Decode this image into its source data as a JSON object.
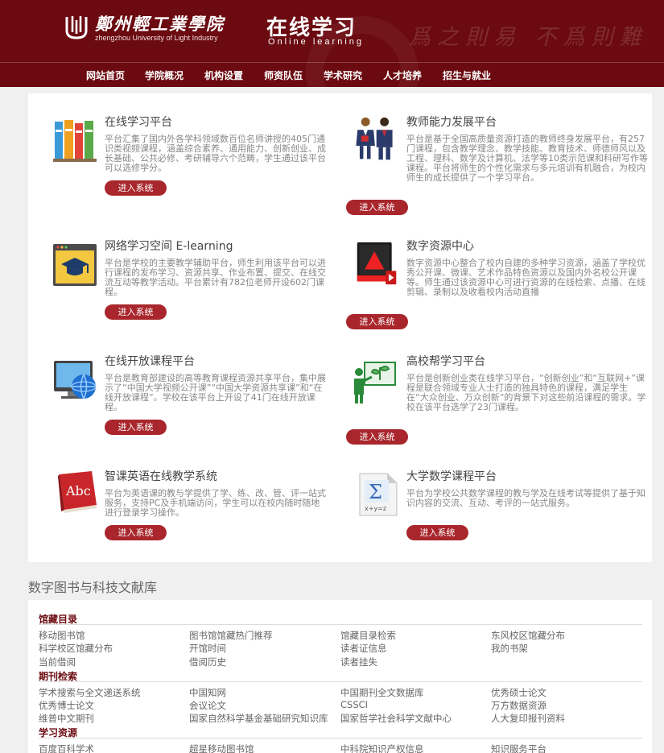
{
  "header": {
    "school_name": "鄭州輕工業學院",
    "school_name_en": "zhengzhou University of Light Industry",
    "page_title": "在线学习",
    "page_subtitle": "Online  learning",
    "calligraphy": "爲之則易 不爲則難",
    "logo_icon": "university-logo-icon"
  },
  "colors": {
    "brand": "#6b0a10",
    "button": "#a8262c",
    "section_heading": "#6b0a10"
  },
  "nav": [
    "网站首页",
    "学院概况",
    "机构设置",
    "师资队伍",
    "学术研究",
    "人才培养",
    "招生与就业"
  ],
  "platforms": [
    {
      "title": "在线学习平台",
      "desc": "平台汇集了国内外各学科领域数百位名师讲授的405门通识类视频课程，涵盖综合素养、通用能力、创新创业、成长基础、公共必修、考研辅导六个范畴，学生通过该平台可以选修学分。",
      "button": "进入系统",
      "icon": "books-icon"
    },
    {
      "title": "教师能力发展平台",
      "desc": "平台是基于全国高质量资源打造的教师终身发展平台，有257门课程，包含教学理念、教学技能、教育技术、师德师风以及工程、理科、数学及计算机、法学等10类示范课和科研写作等课程。平台将师生的个性化需求与多元培训有机融合，为校内师生的成长提供了一个学习平台。",
      "button": "进入系统",
      "icon": "teachers-icon"
    },
    {
      "title": "网络学习空间 E-learning",
      "desc": "平台是学校的主要教学辅助平台，师生利用该平台可以进行课程的发布学习、资源共享、作业布置、提交、在线交流互动等教学活动。平台累计有782位老师开设602门课程。",
      "button": "进入系统",
      "icon": "graduation-cap-icon"
    },
    {
      "title": "数字资源中心",
      "desc": "数字资源中心整合了校内自建的多种学习资源，涵盖了学校优秀公开课、微课、艺术作品特色资源以及国内外名校公开课等。师生通过该资源中心可进行资源的在线检索、点播、在线剪辑、录制以及收看校内活动直播",
      "button": "进入系统",
      "icon": "media-player-icon"
    },
    {
      "title": "在线开放课程平台",
      "desc": "平台是教育部建设的高等教育课程资源共享平台，集中展示了“中国大学视频公开课”“中国大学资源共享课”和“在线开放课程”。学校在该平台上开设了41门在线开放课程。",
      "button": "进入系统",
      "icon": "globe-monitor-icon"
    },
    {
      "title": "高校帮学习平台",
      "desc": "平台是创新创业类在线学习平台，“创新创业”和“互联网+”课程是联合领域专业人士打造的独具特色的课程，满足学生在“大众创业、万众创新”的背景下对这些前沿课程的需求。学校在该平台选学了23门课程。",
      "button": "进入系统",
      "icon": "presentation-board-icon"
    },
    {
      "title": "智课英语在线教学系统",
      "desc": "平台为英语课的教与学提供了学、练、改、管、评一站式服务，支持PC及手机端访问，学生可以在校内随时随地进行登录学习操作。",
      "button": "进入系统",
      "icon": "abc-book-icon"
    },
    {
      "title": "大学数学课程平台",
      "desc": "平台为学校公共数学课程的教与学及在线考试等提供了基于知识内容的交流、互动、考评的一站式服务。",
      "button": "进入系统",
      "icon": "sigma-math-icon"
    }
  ],
  "library": {
    "heading": "数字图书与科技文献库",
    "sections": [
      {
        "title": "馆藏目录",
        "links": [
          "移动图书馆",
          "图书馆馆藏热门推荐",
          "馆藏目录检索",
          "东风校区馆藏分布",
          "科学校区馆藏分布",
          "开馆时间",
          "读者证信息",
          "我的书架",
          "当前借阅",
          "借阅历史",
          "读者挂失"
        ]
      },
      {
        "title": "期刊检索",
        "links": [
          "学术搜索与全文递送系统",
          "中国知网",
          "中国期刊全文数据库",
          "优秀硕士论文",
          "优秀博士论文",
          "会议论文",
          "CSSCI",
          "万方数据资源",
          "维普中文期刊",
          "国家自然科学基金基础研究知识库",
          "国家哲学社会科学文献中心",
          "人大复印报刊资料"
        ]
      },
      {
        "title": "学习资源",
        "links": [
          "百度百科学术",
          "超星移动图书馆",
          "中科院知识产权信息",
          "知识服务平台"
        ]
      }
    ]
  }
}
